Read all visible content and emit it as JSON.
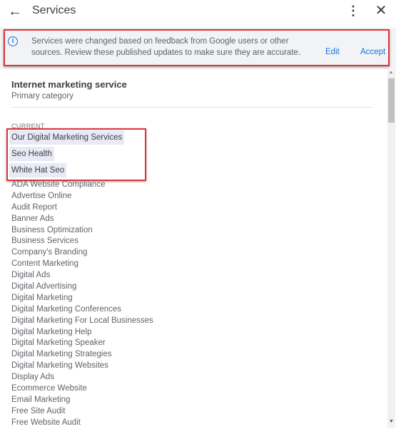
{
  "header": {
    "title": "Services",
    "back_icon": "arrow-left-icon",
    "more_icon": "more-vert-icon",
    "close_icon": "close-icon"
  },
  "banner": {
    "icon": "info-icon",
    "message": "Services were changed based on feedback from Google users or other sources. Review these published updates to make sure they are accurate.",
    "edit_label": "Edit",
    "accept_label": "Accept",
    "accent_color": "#1a73e8",
    "highlight_color": "#e0333a"
  },
  "category": {
    "name": "Internet marketing service",
    "label": "Primary category"
  },
  "current": {
    "label": "CURRENT",
    "highlighted": [
      "Our Digital Marketing Services",
      "Seo Health",
      "White Hat Seo"
    ],
    "services": [
      "ADA Website Compliance",
      "Advertise Online",
      "Audit Report",
      "Banner Ads",
      "Business Optimization",
      "Business Services",
      "Company's Branding",
      "Content Marketing",
      "Digital Ads",
      "Digital Advertising",
      "Digital Marketing",
      "Digital Marketing Conferences",
      "Digital Marketing For Local Businesses",
      "Digital Marketing Help",
      "Digital Marketing Speaker",
      "Digital Marketing Strategies",
      "Digital Marketing Websites",
      "Display Ads",
      "Ecommerce Website",
      "Email Marketing",
      "Free Site Audit",
      "Free Website Audit"
    ]
  }
}
